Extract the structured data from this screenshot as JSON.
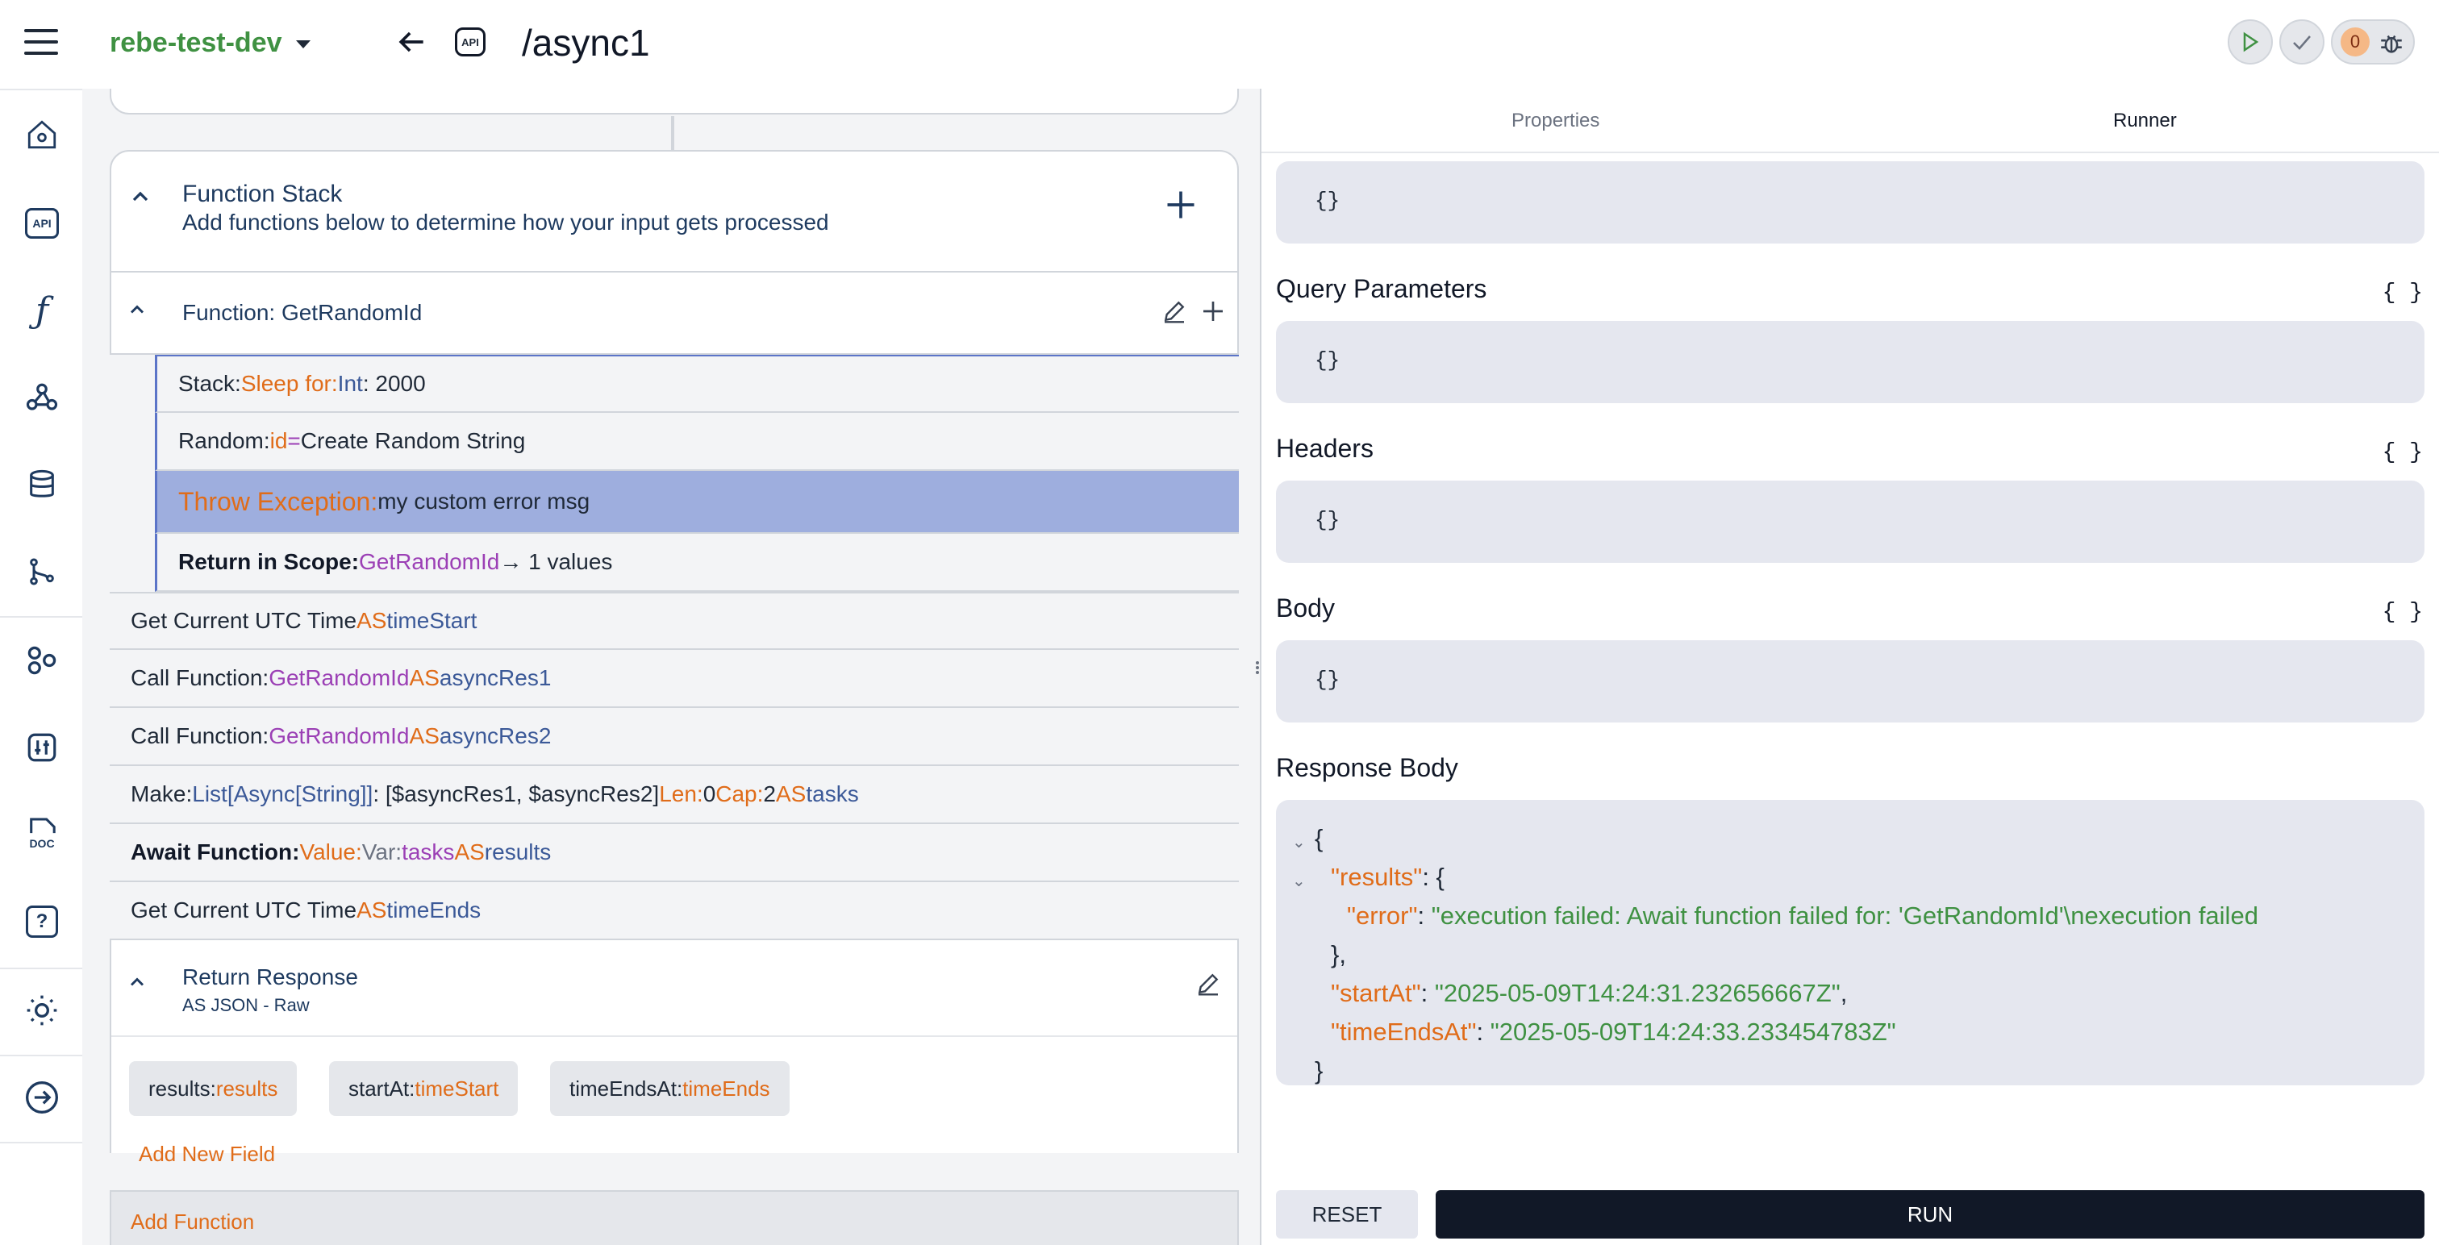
{
  "header": {
    "project": "rebe-test-dev",
    "api_badge": "API",
    "endpoint": "/async1",
    "counter": "0"
  },
  "sidebar": {
    "items": [
      "home-icon",
      "api-icon",
      "function-icon",
      "webhook-icon",
      "database-icon",
      "branch-icon",
      "components-icon",
      "tools-icon",
      "doc-icon",
      "help-icon",
      "theme-icon",
      "logout-icon"
    ],
    "api_label": "API",
    "doc_label": "DOC"
  },
  "function_stack": {
    "title": "Function Stack",
    "subtitle": "Add functions below to determine how your input gets processed"
  },
  "function": {
    "title": "Function: GetRandomId",
    "rows": [
      {
        "k1": "Stack: ",
        "k2": "Sleep for: ",
        "k3": "Int",
        "k4": ": 2000"
      },
      {
        "k1": "Random: ",
        "k2": "id",
        "k3": " = ",
        "k4": "Create Random String"
      },
      {
        "k1": "Throw Exception: ",
        "k2": "my custom error msg"
      },
      {
        "k1": "Return in Scope: ",
        "k2": "GetRandomId",
        "k3": " → 1 values"
      }
    ]
  },
  "steps": [
    {
      "a": "Get Current UTC Time ",
      "b": "AS",
      "c": " timeStart"
    },
    {
      "a": "Call Function: ",
      "b": "GetRandomId",
      "c": " AS",
      "d": " asyncRes1"
    },
    {
      "a": "Call Function: ",
      "b": "GetRandomId",
      "c": " AS",
      "d": " asyncRes2"
    },
    {
      "a": "Make: ",
      "b": "List[Async[String]]",
      "c": ": [$asyncRes1, $asyncRes2] ",
      "d": "Len:",
      "e": " 0 ",
      "f": "Cap:",
      "g": " 2 ",
      "h": "AS",
      "i": " tasks"
    },
    {
      "a": "Await Function: ",
      "b": "Value:",
      "c": " Var: ",
      "d": "tasks",
      "e": " AS",
      "f": " results"
    },
    {
      "a": "Get Current UTC Time ",
      "b": "AS",
      "c": " timeEnds"
    }
  ],
  "return_response": {
    "title": "Return Response",
    "subtitle": "AS JSON - Raw",
    "chips": [
      {
        "key": "results: ",
        "val": "results"
      },
      {
        "key": "startAt: ",
        "val": "timeStart"
      },
      {
        "key": "timeEndsAt: ",
        "val": "timeEnds"
      }
    ],
    "add_field": "Add New Field"
  },
  "add_function": "Add Function",
  "runner": {
    "tabs": [
      "Properties",
      "Runner"
    ],
    "top_value": "{}",
    "query_label": "Query Parameters",
    "query_value": "{}",
    "headers_label": "Headers",
    "headers_value": "{}",
    "body_label": "Body",
    "body_value": "{}",
    "braces": "{ }",
    "response_label": "Response Body",
    "response": {
      "open": "{",
      "results_key": "\"results\"",
      "results_open": ": {",
      "error_key": "\"error\"",
      "error_val": "\"execution failed: Await function failed for: 'GetRandomId'\\nexecution failed",
      "results_close": "},",
      "start_key": "\"startAt\"",
      "start_val": "\"2025-05-09T14:24:31.232656667Z\"",
      "end_key": "\"timeEndsAt\"",
      "end_val": "\"2025-05-09T14:24:33.233454783Z\"",
      "close": "}"
    },
    "reset_label": "RESET",
    "run_label": "RUN"
  }
}
